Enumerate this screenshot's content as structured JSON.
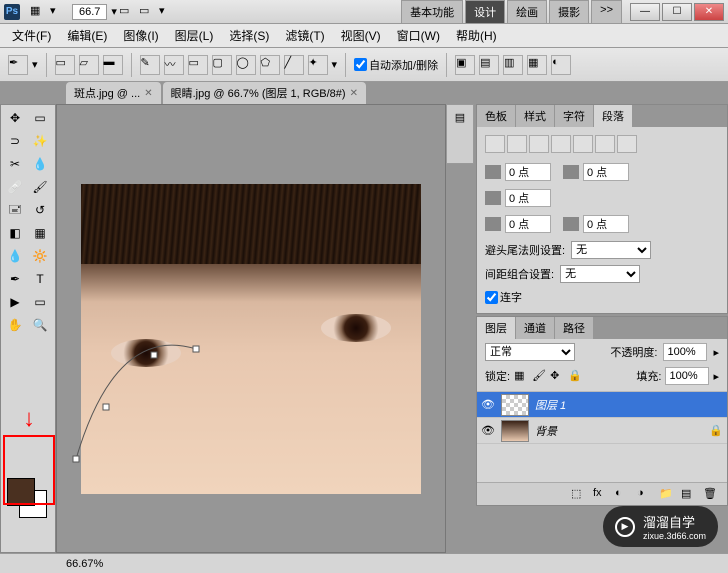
{
  "titlebar": {
    "zoom": "66.7",
    "workspaces": {
      "basic": "基本功能",
      "design": "设计",
      "paint": "绘画",
      "photo": "摄影",
      "more": ">>"
    }
  },
  "menu": {
    "file": "文件(F)",
    "edit": "编辑(E)",
    "image": "图像(I)",
    "layer": "图层(L)",
    "select": "选择(S)",
    "filter": "滤镜(T)",
    "view": "视图(V)",
    "window": "窗口(W)",
    "help": "帮助(H)"
  },
  "options": {
    "auto_add_delete": "自动添加/删除"
  },
  "docs": {
    "tab1": "斑点.jpg @ ...",
    "tab2": "眼睛.jpg @ 66.7% (图层 1, RGB/8#)"
  },
  "panels": {
    "para_group": {
      "tabs": {
        "color": "色板",
        "style": "样式",
        "char": "字符",
        "para": "段落"
      },
      "indent1": "0 点",
      "indent2": "0 点",
      "indent3": "0 点",
      "indent4": "0 点",
      "indent5": "0 点",
      "break_label": "避头尾法则设置:",
      "break_val": "无",
      "gap_label": "间距组合设置:",
      "gap_val": "无",
      "hyphen": "连字"
    },
    "layer_group": {
      "tabs": {
        "layer": "图层",
        "channel": "通道",
        "path": "路径"
      },
      "mode": "正常",
      "opacity_label": "不透明度:",
      "opacity": "100%",
      "lock_label": "锁定:",
      "fill_label": "填充:",
      "fill": "100%",
      "layers": [
        {
          "name": "图层 1",
          "selected": true,
          "thumb": "checker"
        },
        {
          "name": "背景",
          "selected": false,
          "thumb": "img",
          "locked": true
        }
      ]
    }
  },
  "status": {
    "zoom": "66.67%"
  },
  "watermark": {
    "text1": "溜溜自学",
    "text2": "zixue.3d66.com"
  }
}
